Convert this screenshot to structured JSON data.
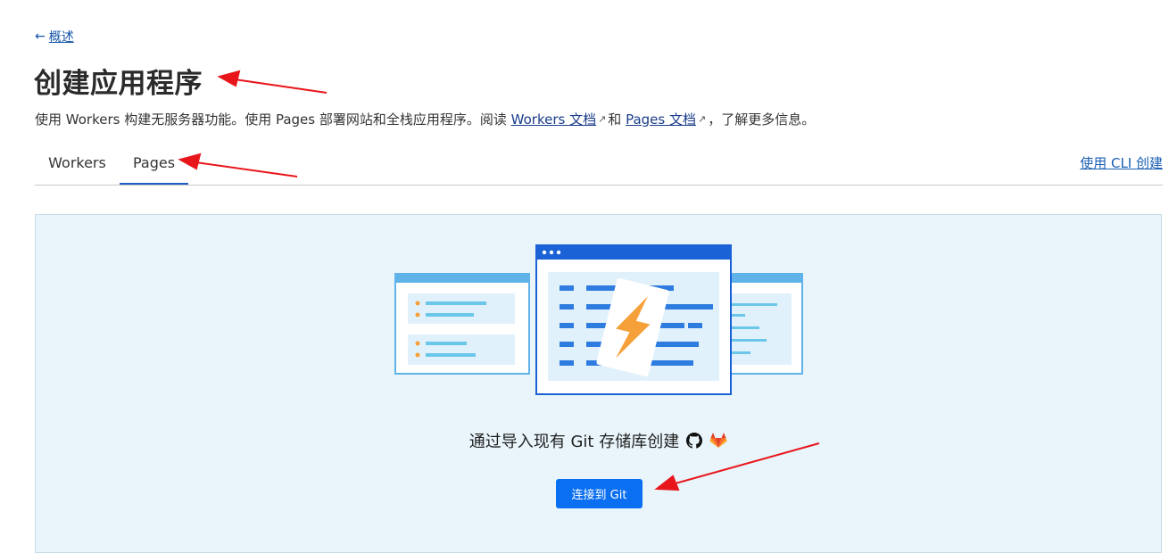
{
  "nav": {
    "back_label": "概述"
  },
  "page": {
    "title": "创建应用程序"
  },
  "description": {
    "before": "使用 Workers 构建无服务器功能。使用 Pages 部署网站和全栈应用程序。阅读 ",
    "workers_docs": "Workers 文档",
    "middle": "和 ",
    "pages_docs": "Pages 文档",
    "after": "，了解更多信息。"
  },
  "tabs": [
    {
      "label": "Workers",
      "active": false
    },
    {
      "label": "Pages",
      "active": true
    }
  ],
  "cli_link": "使用 CLI 创建",
  "pages_panel": {
    "git_text": "通过导入现有 Git 存储库创建",
    "connect_button": "连接到 Git",
    "icons": [
      "github-icon",
      "gitlab-icon"
    ]
  },
  "colors": {
    "accent": "#0b6ff2",
    "panel_bg": "#e9f5fb",
    "annotation": "#e8161b"
  }
}
